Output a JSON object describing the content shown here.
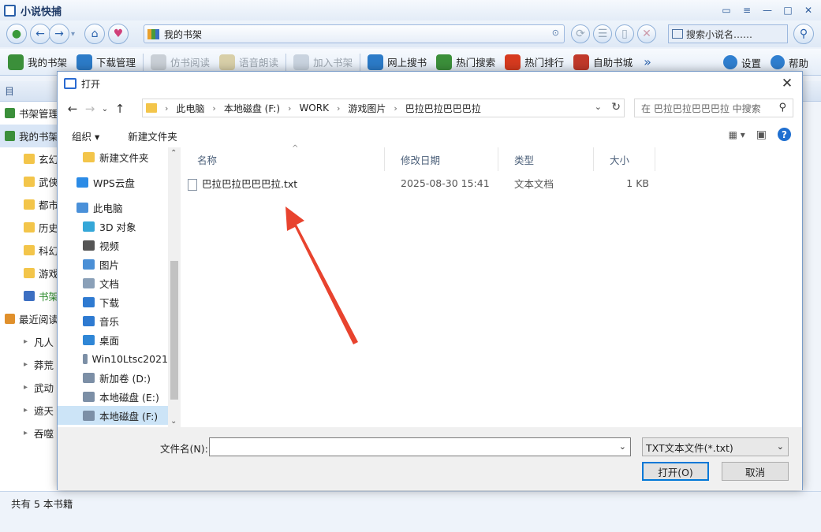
{
  "app": {
    "title": "小说快捕",
    "address": "我的书架",
    "search_placeholder": "搜索小说名……"
  },
  "toolbar": [
    {
      "label": "我的书架",
      "enabled": true,
      "icon": "books-icon",
      "color": "#3b8f3a"
    },
    {
      "label": "下载管理",
      "enabled": true,
      "icon": "globe-download-icon",
      "color": "#2c7bc8"
    },
    {
      "label": "仿书阅读",
      "enabled": false,
      "icon": "book-icon",
      "color": "#c9cfd6"
    },
    {
      "label": "语音朗读",
      "enabled": false,
      "icon": "microphone-icon",
      "color": "#d8cfa8"
    },
    {
      "label": "加入书架",
      "enabled": false,
      "icon": "add-to-shelf-icon",
      "color": "#c9d3df"
    },
    {
      "label": "网上搜书",
      "enabled": true,
      "icon": "search-globe-icon",
      "color": "#2c7bc8"
    },
    {
      "label": "热门搜索",
      "enabled": true,
      "icon": "globe-icon",
      "color": "#3b8f3a"
    },
    {
      "label": "热门排行",
      "enabled": true,
      "icon": "hot-icon",
      "color": "#d63a1f"
    },
    {
      "label": "自助书城",
      "enabled": true,
      "icon": "bookstore-icon",
      "color": "#c0392b"
    }
  ],
  "toolbar_right": [
    {
      "label": "设置",
      "icon": "settings-icon"
    },
    {
      "label": "帮助",
      "icon": "help-icon"
    }
  ],
  "left_panel": {
    "header": "目",
    "items": [
      {
        "label": "书架管理",
        "icon": "leaf-icon",
        "indent": 0
      },
      {
        "label": "我的书架",
        "icon": "books-icon",
        "indent": 0
      },
      {
        "label": "玄幻",
        "icon": "folder-icon",
        "indent": 1
      },
      {
        "label": "武侠",
        "icon": "folder-icon",
        "indent": 1
      },
      {
        "label": "都市",
        "icon": "folder-icon",
        "indent": 1
      },
      {
        "label": "历史",
        "icon": "folder-icon",
        "indent": 1
      },
      {
        "label": "科幻",
        "icon": "folder-icon",
        "indent": 1
      },
      {
        "label": "游戏",
        "icon": "folder-icon",
        "indent": 1
      },
      {
        "label": "书架",
        "icon": "search-icon",
        "indent": 1
      },
      {
        "label": "最近阅读",
        "icon": "clock-icon",
        "indent": 0
      },
      {
        "label": "凡人",
        "icon": "triangle-icon",
        "indent": 1
      },
      {
        "label": "莽荒",
        "icon": "triangle-icon",
        "indent": 1
      },
      {
        "label": "武动",
        "icon": "triangle-icon",
        "indent": 1
      },
      {
        "label": "遮天",
        "icon": "triangle-icon",
        "indent": 1
      },
      {
        "label": "吞噬",
        "icon": "triangle-icon",
        "indent": 1
      }
    ]
  },
  "statusbar": "共有 5 本书籍",
  "dialog": {
    "title": "打开",
    "breadcrumbs": [
      "此电脑",
      "本地磁盘 (F:)",
      "WORK",
      "游戏图片",
      "巴拉巴拉巴巴巴拉"
    ],
    "search_placeholder": "在 巴拉巴拉巴巴巴拉 中搜索",
    "commands": {
      "organize": "组织 ▾",
      "new_folder": "新建文件夹"
    },
    "nav_tree": [
      {
        "label": "新建文件夹",
        "icon": "folder-icon",
        "color": "#f3c54a",
        "indent": 2,
        "selected": false
      },
      {
        "label": "WPS云盘",
        "icon": "cloud-icon",
        "color": "#2b8be6",
        "indent": 1,
        "selected": false
      },
      {
        "label": "此电脑",
        "icon": "computer-icon",
        "color": "#4a90d9",
        "indent": 1,
        "selected": false
      },
      {
        "label": "3D 对象",
        "icon": "cube-icon",
        "color": "#35a7d8",
        "indent": 2,
        "selected": false
      },
      {
        "label": "视频",
        "icon": "video-icon",
        "color": "#555",
        "indent": 2,
        "selected": false
      },
      {
        "label": "图片",
        "icon": "picture-icon",
        "color": "#4a8fd6",
        "indent": 2,
        "selected": false
      },
      {
        "label": "文档",
        "icon": "document-icon",
        "color": "#8aa0b8",
        "indent": 2,
        "selected": false
      },
      {
        "label": "下载",
        "icon": "download-icon",
        "color": "#2e7ad1",
        "indent": 2,
        "selected": false
      },
      {
        "label": "音乐",
        "icon": "music-icon",
        "color": "#2e7ad1",
        "indent": 2,
        "selected": false
      },
      {
        "label": "桌面",
        "icon": "desktop-icon",
        "color": "#2f86d6",
        "indent": 2,
        "selected": false
      },
      {
        "label": "Win10Ltsc2021",
        "icon": "drive-icon",
        "color": "#7c8fa6",
        "indent": 2,
        "selected": false
      },
      {
        "label": "新加卷 (D:)",
        "icon": "drive-icon",
        "color": "#7c8fa6",
        "indent": 2,
        "selected": false
      },
      {
        "label": "本地磁盘 (E:)",
        "icon": "drive-icon",
        "color": "#7c8fa6",
        "indent": 2,
        "selected": false
      },
      {
        "label": "本地磁盘 (F:)",
        "icon": "drive-icon",
        "color": "#7c8fa6",
        "indent": 2,
        "selected": true
      }
    ],
    "columns": [
      "名称",
      "修改日期",
      "类型",
      "大小"
    ],
    "files": [
      {
        "name": "巴拉巴拉巴巴巴拉.txt",
        "modified": "2025-08-30 15:41",
        "type": "文本文档",
        "size": "1 KB"
      }
    ],
    "filename_label": "文件名(N):",
    "filename_value": "",
    "filetype": "TXT文本文件(*.txt)",
    "open_label": "打开(O)",
    "cancel_label": "取消"
  },
  "annotation_color": "#e8432e"
}
